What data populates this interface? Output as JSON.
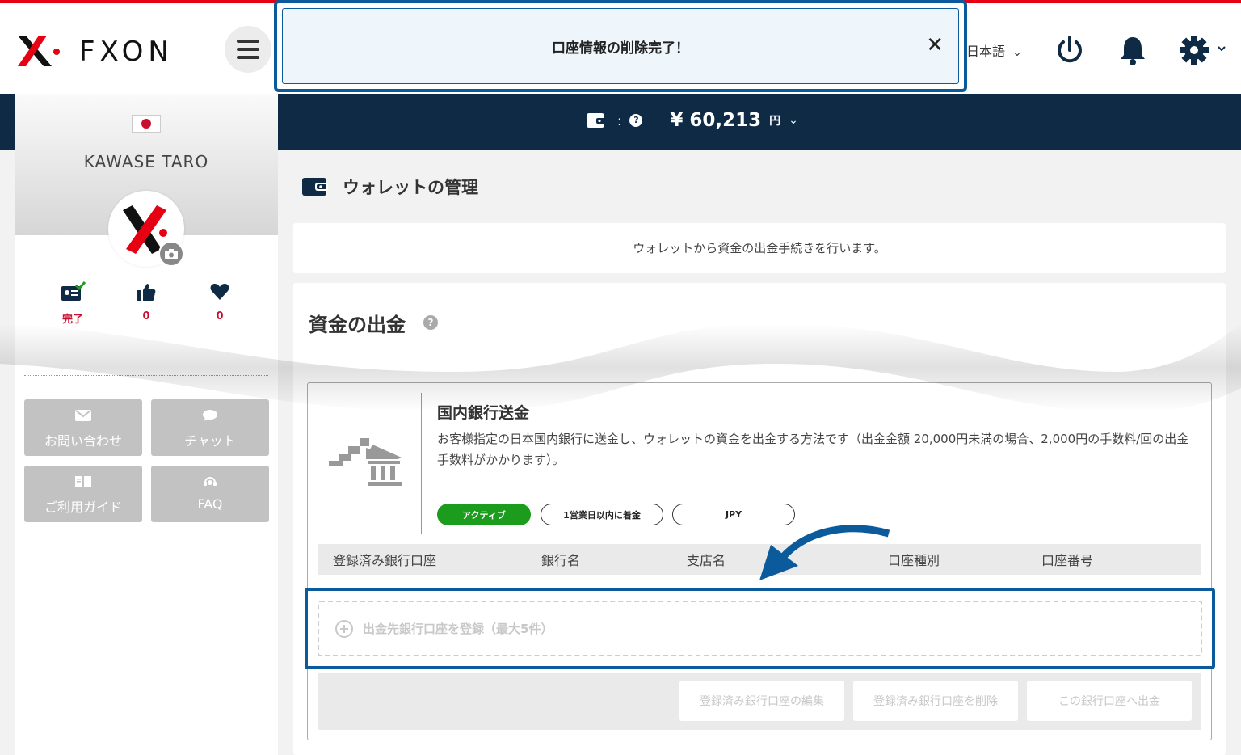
{
  "header": {
    "logo_text": "FXON",
    "language": "日本語",
    "icons": [
      "menu-icon",
      "power-icon",
      "bell-icon",
      "gear-icon"
    ]
  },
  "toast": {
    "message": "口座情報の削除完了！",
    "close": "✕"
  },
  "balance": {
    "separator": ":",
    "amount": "¥ 60,213",
    "unit": "円"
  },
  "profile": {
    "name": "KAWASE TARO",
    "stats": [
      {
        "icon": "id-card-check-icon",
        "value": "完了"
      },
      {
        "icon": "thumbs-up-icon",
        "value": "0"
      },
      {
        "icon": "heart-icon",
        "value": "0"
      }
    ],
    "buttons": [
      {
        "icon": "mail-icon",
        "label": "お問い合わせ"
      },
      {
        "icon": "chat-icon",
        "label": "チャット"
      },
      {
        "icon": "book-icon",
        "label": "ご利用ガイド"
      },
      {
        "icon": "support-icon",
        "label": "FAQ"
      }
    ]
  },
  "main": {
    "section_title": "ウォレットの管理",
    "intro": "ウォレットから資金の出金手続きを行います。",
    "withdraw_title": "資金の出金",
    "bank": {
      "title": "国内銀行送金",
      "description": "お客様指定の日本国内銀行に送金し、ウォレットの資金を出金する方法です（出金金額 20,000円未満の場合、2,000円の手数料/回の出金手数料がかかります）。",
      "badges": [
        "アクティブ",
        "1営業日以内に着金",
        "JPY"
      ]
    },
    "table_headers": [
      "登録済み銀行口座",
      "銀行名",
      "支店名",
      "口座種別",
      "口座番号"
    ],
    "register_label": "出金先銀行口座を登録（最大5件）",
    "actions": [
      "登録済み銀行口座の編集",
      "登録済み銀行口座を削除",
      "この銀行口座へ出金"
    ]
  },
  "colors": {
    "brand_red": "#e60012",
    "navy": "#0f2a45",
    "highlight_blue": "#0a5a9c",
    "active_green": "#1c9c1c"
  }
}
